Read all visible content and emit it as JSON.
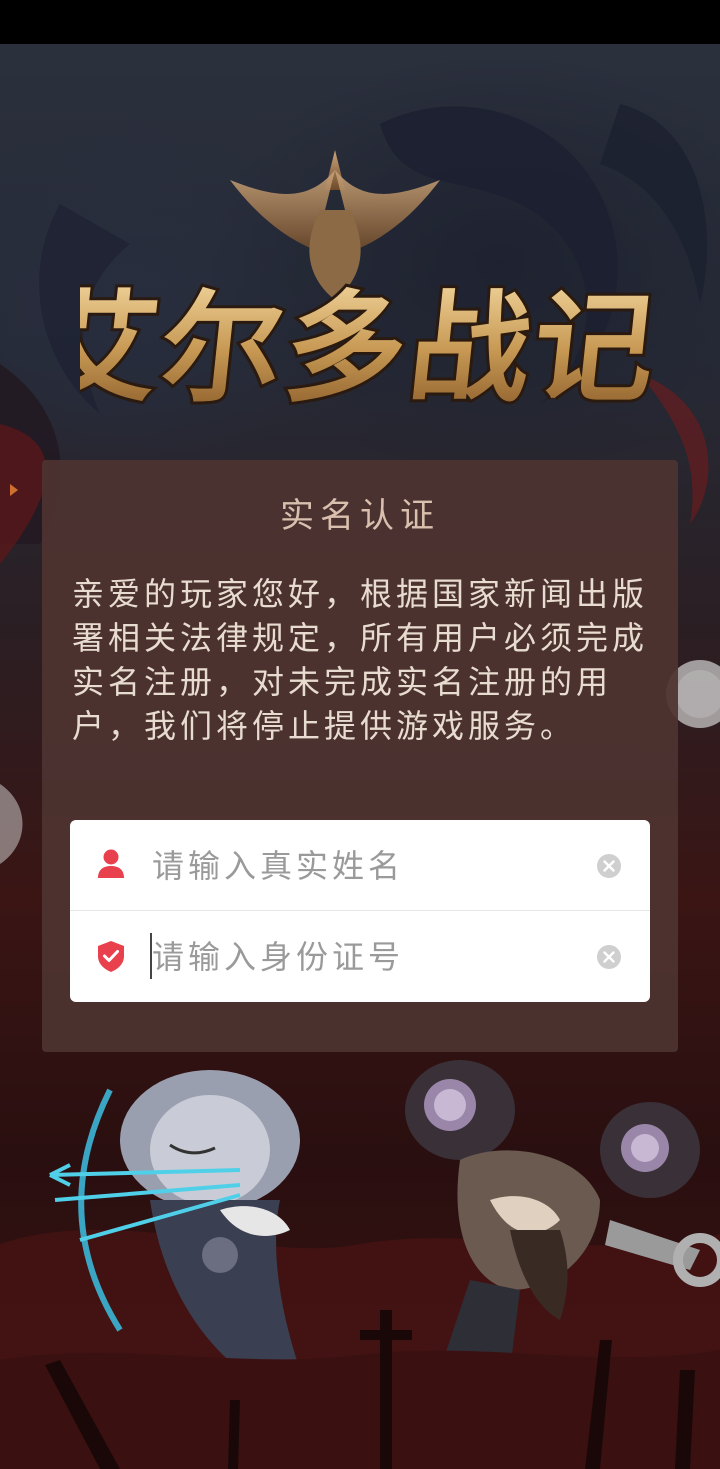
{
  "game": {
    "logo_text": "艾尔多战记"
  },
  "dialog": {
    "title": "实名认证",
    "body": "亲爱的玩家您好，根据国家新闻出版署相关法律规定，所有用户必须完成实名注册，对未完成实名注册的用户，我们将停止提供游戏服务。"
  },
  "form": {
    "name_placeholder": "请输入真实姓名",
    "name_value": "",
    "id_placeholder": "请输入身份证号",
    "id_value": ""
  },
  "icons": {
    "name_icon": "user-icon",
    "id_icon": "shield-check-icon",
    "clear_icon": "clear-icon"
  },
  "colors": {
    "accent": "#e8404c",
    "dialog_bg": "#4e3430",
    "title_text": "#d9bfae",
    "body_text": "#e8dcd0",
    "placeholder": "#9a9a9a"
  }
}
